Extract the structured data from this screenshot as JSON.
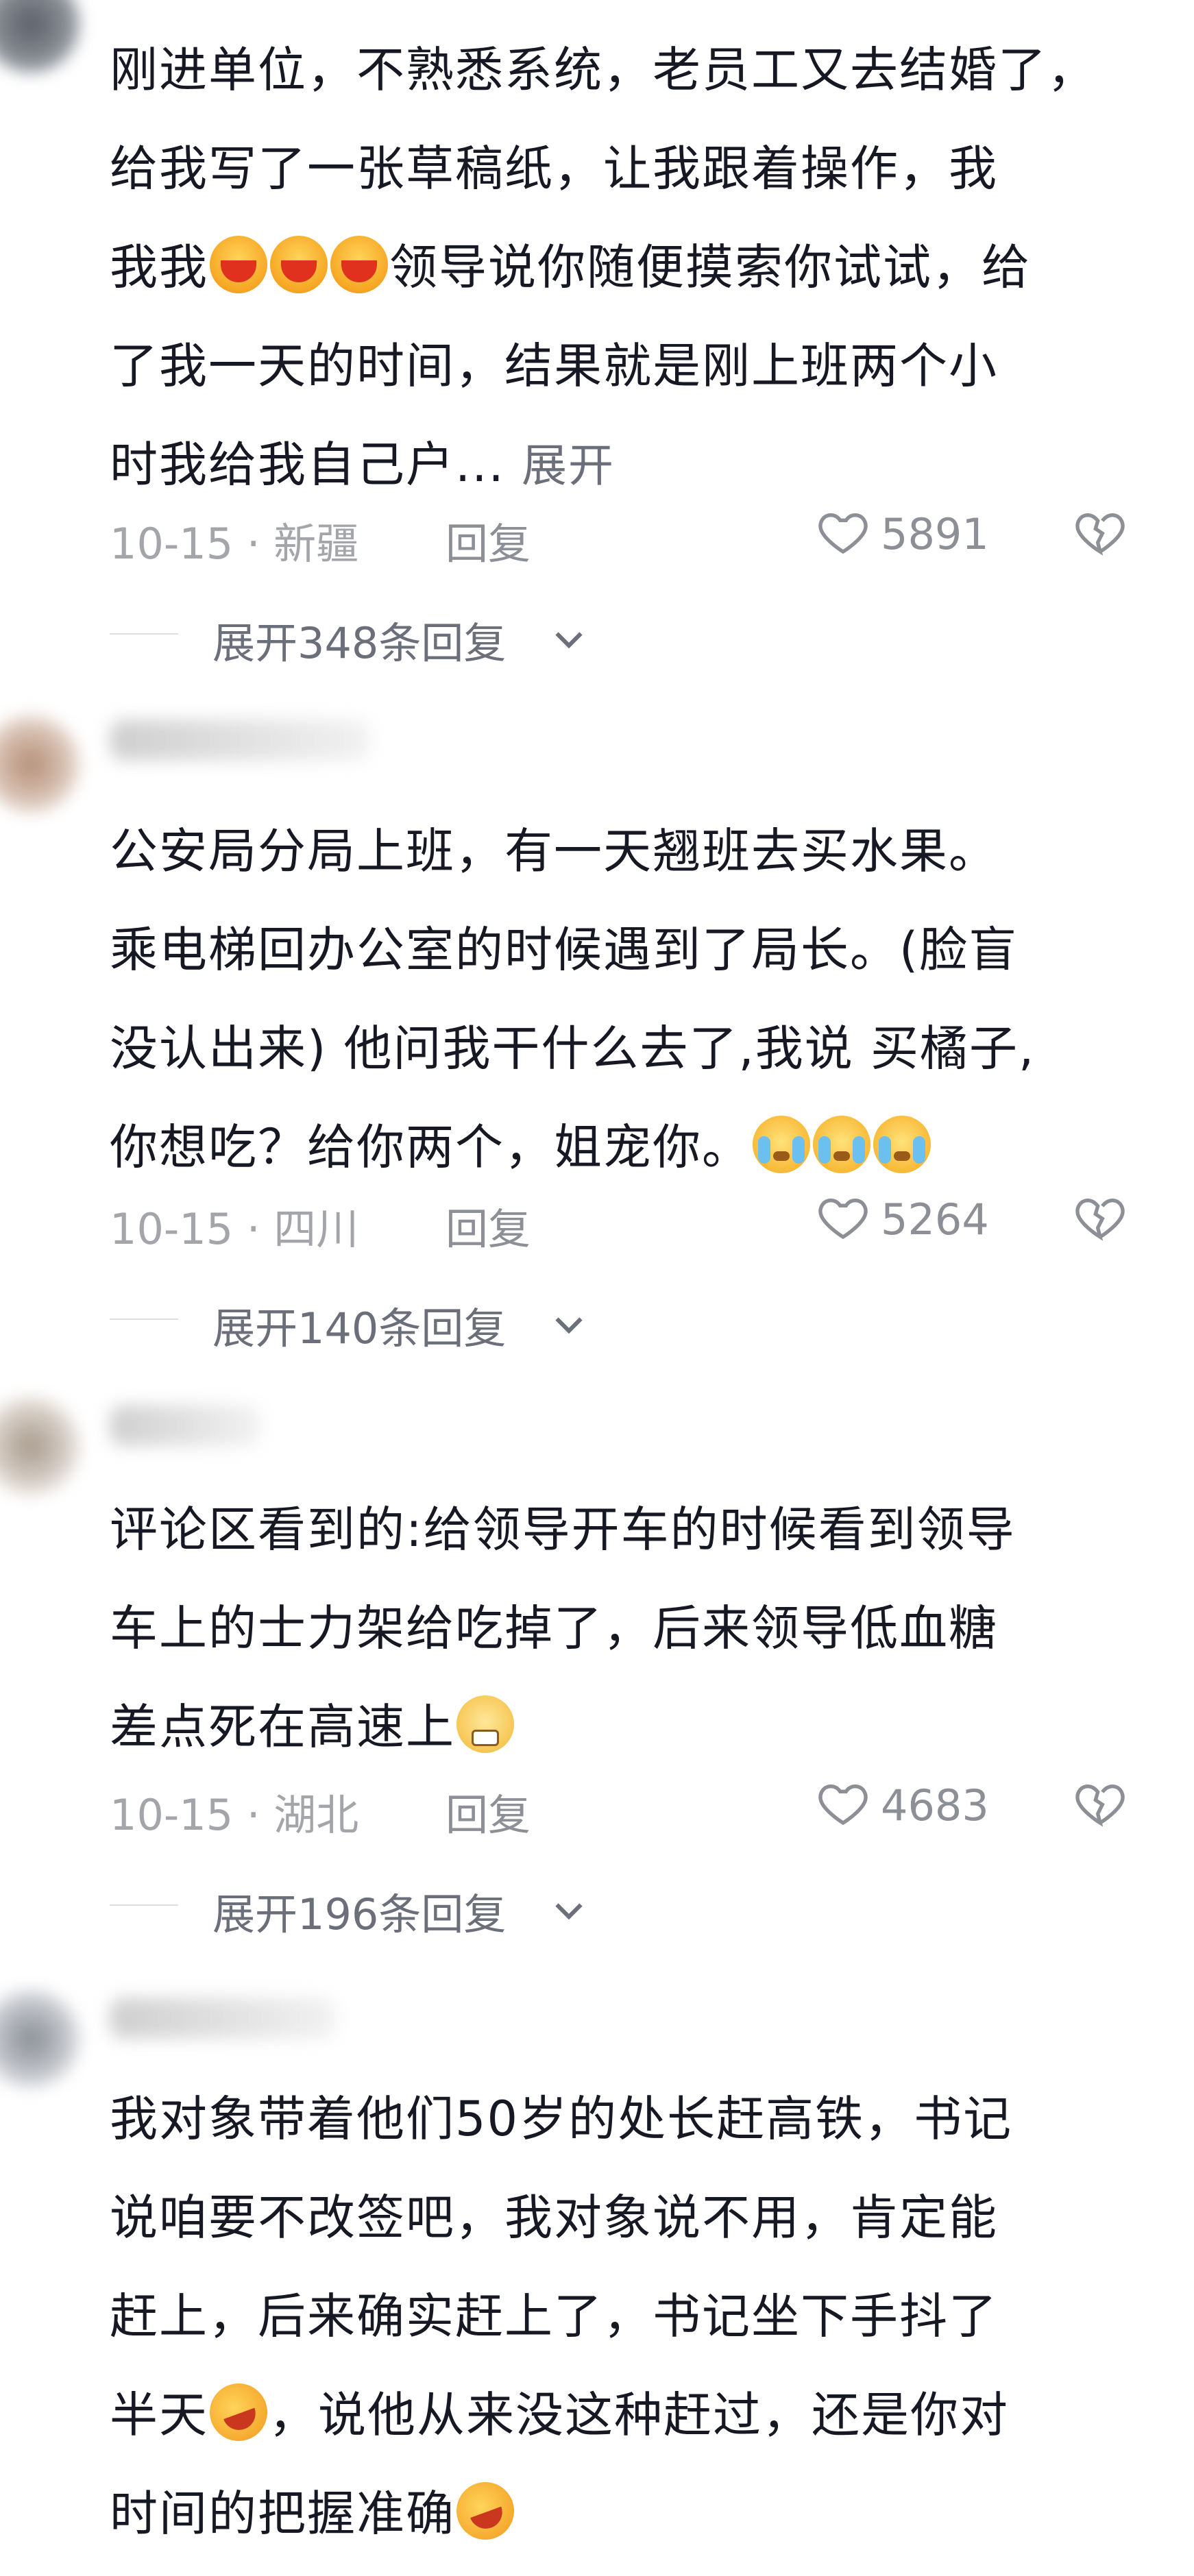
{
  "comments": [
    {
      "lines": [
        "刚进单位，不熟悉系统，老员工又去结婚了，",
        "给我写了一张草稿纸，让我跟着操作，我",
        "我我",
        "领导说你随便摸索你试试，给",
        "了我一天的时间，结果就是刚上班两个小",
        "时我给我自己户...",
        "展开"
      ],
      "date_location": "10-15 · 新疆",
      "reply_label": "回复",
      "likes": "5891",
      "expand_replies": "展开348条回复"
    },
    {
      "lines": [
        "公安局分局上班，有一天翘班去买水果。",
        "乘电梯回办公室的时候遇到了局长。(脸盲",
        "没认出来) 他问我干什么去了,我说 买橘子,",
        "你想吃？给你两个，姐宠你。"
      ],
      "date_location": "10-15 · 四川",
      "reply_label": "回复",
      "likes": "5264",
      "expand_replies": "展开140条回复"
    },
    {
      "lines": [
        "评论区看到的:给领导开车的时候看到领导",
        "车上的士力架给吃掉了，后来领导低血糖",
        "差点死在高速上"
      ],
      "date_location": "10-15 · 湖北",
      "reply_label": "回复",
      "likes": "4683",
      "expand_replies": "展开196条回复"
    },
    {
      "lines": [
        "我对象带着他们50岁的处长赶高铁，书记",
        "说咱要不改签吧，我对象说不用，肯定能",
        "赶上，后来确实赶上了，书记坐下手抖了",
        "半天",
        "，说他从来没这种赶过，还是你对",
        "时间的把握准确"
      ]
    }
  ],
  "icons": {
    "like": "heart-outline-icon",
    "dislike": "broken-heart-icon",
    "chevron": "chevron-down-icon",
    "emoji_laugh": "laughing-emoji-icon",
    "emoji_cry": "crying-laugh-emoji-icon",
    "emoji_grimace": "grimace-emoji-icon",
    "emoji_rofl": "rolling-laugh-emoji-icon"
  },
  "colors": {
    "text": "#161823",
    "meta": "#a3a5ab",
    "secondary": "#6b6f7a"
  }
}
